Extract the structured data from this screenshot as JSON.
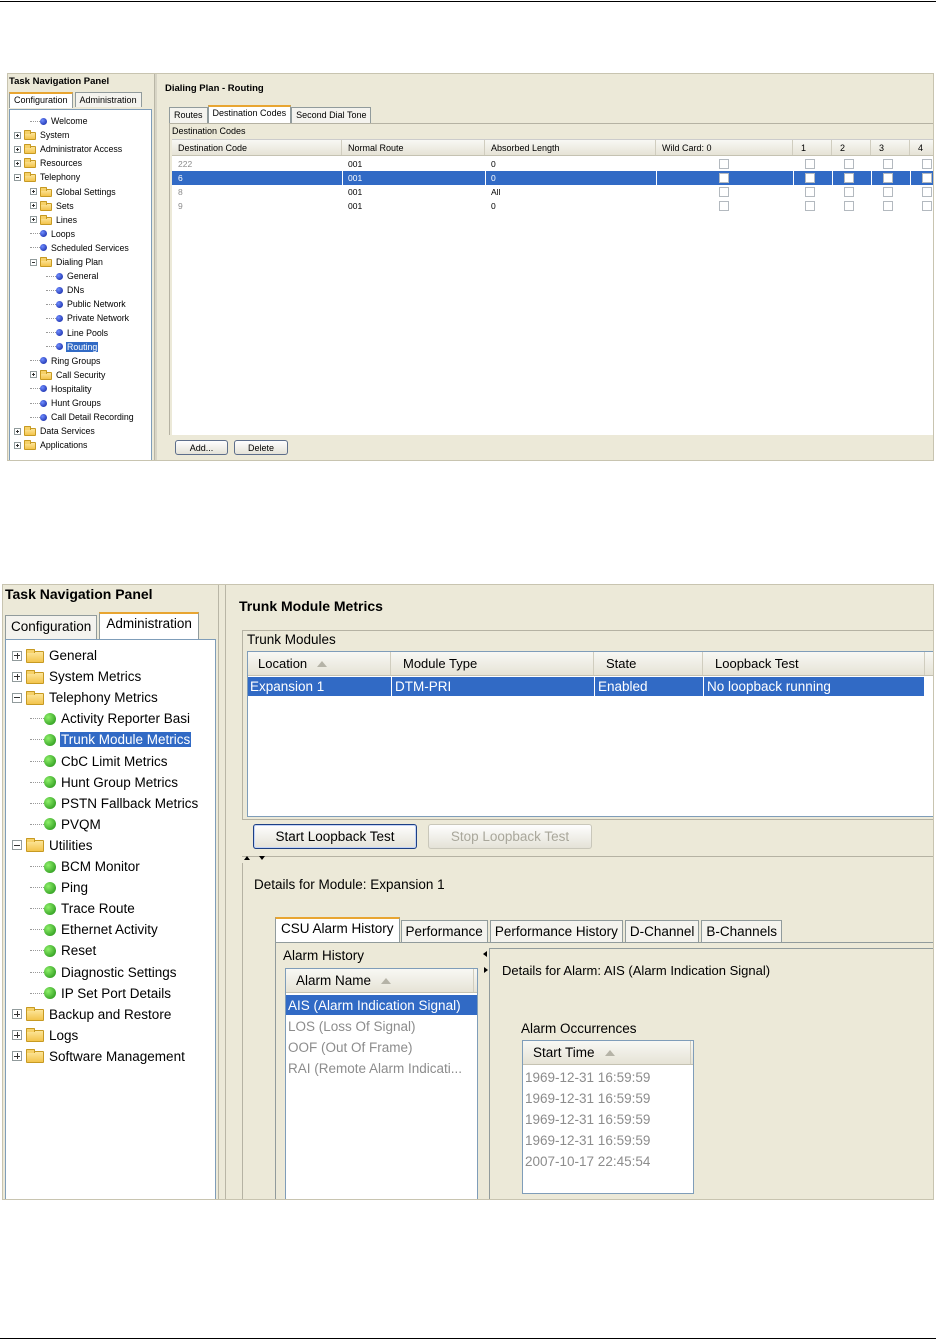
{
  "top": {
    "panel_title": "Task Navigation Panel",
    "tabs": [
      "Configuration",
      "Administration"
    ],
    "tree": [
      {
        "label": "Welcome",
        "icon": "bullet-blue"
      },
      {
        "label": "System",
        "icon": "folder"
      },
      {
        "label": "Administrator Access",
        "icon": "folder"
      },
      {
        "label": "Resources",
        "icon": "folder"
      },
      {
        "label": "Telephony",
        "icon": "folder"
      },
      {
        "label": "Global Settings",
        "icon": "folder"
      },
      {
        "label": "Sets",
        "icon": "folder"
      },
      {
        "label": "Lines",
        "icon": "folder"
      },
      {
        "label": "Loops",
        "icon": "bullet-blue"
      },
      {
        "label": "Scheduled Services",
        "icon": "bullet-blue"
      },
      {
        "label": "Dialing Plan",
        "icon": "folder"
      },
      {
        "label": "General",
        "icon": "bullet-blue"
      },
      {
        "label": "DNs",
        "icon": "bullet-blue"
      },
      {
        "label": "Public Network",
        "icon": "bullet-blue"
      },
      {
        "label": "Private Network",
        "icon": "bullet-blue"
      },
      {
        "label": "Line Pools",
        "icon": "bullet-blue"
      },
      {
        "label": "Routing",
        "icon": "bullet-blue",
        "selected": true
      },
      {
        "label": "Ring Groups",
        "icon": "bullet-blue"
      },
      {
        "label": "Call Security",
        "icon": "folder"
      },
      {
        "label": "Hospitality",
        "icon": "bullet-blue"
      },
      {
        "label": "Hunt Groups",
        "icon": "bullet-blue"
      },
      {
        "label": "Call Detail Recording",
        "icon": "bullet-blue"
      },
      {
        "label": "Data Services",
        "icon": "folder"
      },
      {
        "label": "Applications",
        "icon": "folder"
      }
    ],
    "page_title": "Dialing Plan - Routing",
    "content_tabs": [
      "Routes",
      "Destination Codes",
      "Second Dial Tone"
    ],
    "group_label": "Destination Codes",
    "columns": [
      "Destination Code",
      "Normal Route",
      "Absorbed Length",
      "Wild Card: 0",
      "1",
      "2",
      "3",
      "4"
    ],
    "rows": [
      {
        "code": "222",
        "route": "001",
        "absorbed": "0"
      },
      {
        "code": "6",
        "route": "001",
        "absorbed": "0",
        "selected": true
      },
      {
        "code": "8",
        "route": "001",
        "absorbed": "All"
      },
      {
        "code": "9",
        "route": "001",
        "absorbed": "0"
      }
    ],
    "buttons": {
      "add": "Add...",
      "delete": "Delete"
    }
  },
  "bottom": {
    "panel_title": "Task Navigation Panel",
    "tabs": [
      "Configuration",
      "Administration"
    ],
    "tree": [
      {
        "label": "General",
        "icon": "folder"
      },
      {
        "label": "System Metrics",
        "icon": "folder"
      },
      {
        "label": "Telephony Metrics",
        "icon": "folder"
      },
      {
        "label": "Activity Reporter Basi",
        "icon": "bullet-green"
      },
      {
        "label": "Trunk Module Metrics",
        "icon": "bullet-green",
        "selected": true
      },
      {
        "label": "CbC Limit Metrics",
        "icon": "bullet-green"
      },
      {
        "label": "Hunt Group Metrics",
        "icon": "bullet-green"
      },
      {
        "label": "PSTN Fallback Metrics",
        "icon": "bullet-green"
      },
      {
        "label": "PVQM",
        "icon": "bullet-green"
      },
      {
        "label": "Utilities",
        "icon": "folder"
      },
      {
        "label": "BCM Monitor",
        "icon": "bullet-green"
      },
      {
        "label": "Ping",
        "icon": "bullet-green"
      },
      {
        "label": "Trace Route",
        "icon": "bullet-green"
      },
      {
        "label": "Ethernet Activity",
        "icon": "bullet-green"
      },
      {
        "label": "Reset",
        "icon": "bullet-green"
      },
      {
        "label": "Diagnostic Settings",
        "icon": "bullet-green"
      },
      {
        "label": "IP Set Port Details",
        "icon": "bullet-green"
      },
      {
        "label": "Backup and Restore",
        "icon": "folder"
      },
      {
        "label": "Logs",
        "icon": "folder"
      },
      {
        "label": "Software Management",
        "icon": "folder"
      }
    ],
    "page_title": "Trunk Module Metrics",
    "group_label": "Trunk Modules",
    "columns": [
      "Location",
      "Module Type",
      "State",
      "Loopback Test"
    ],
    "rows": [
      {
        "location": "Expansion 1",
        "type": "DTM-PRI",
        "state": "Enabled",
        "loopback": "No loopback running",
        "selected": true
      }
    ],
    "buttons": {
      "start": "Start Loopback Test",
      "stop": "Stop Loopback Test"
    },
    "details_title": "Details for Module: Expansion 1",
    "detail_tabs": [
      "CSU Alarm History",
      "Performance",
      "Performance History",
      "D-Channel",
      "B-Channels"
    ],
    "alarm_history_label": "Alarm History",
    "alarm_column": "Alarm Name",
    "alarms": [
      {
        "name": "AIS (Alarm Indication Signal)",
        "selected": true
      },
      {
        "name": "LOS (Loss Of Signal)"
      },
      {
        "name": "OOF (Out Of Frame)"
      },
      {
        "name": "RAI (Remote Alarm Indicati..."
      }
    ],
    "alarm_details_title": "Details for Alarm: AIS (Alarm Indication Signal)",
    "occurrences_label": "Alarm Occurrences",
    "occurrences_column": "Start Time",
    "occurrences": [
      "1969-12-31 16:59:59",
      "1969-12-31 16:59:59",
      "1969-12-31 16:59:59",
      "1969-12-31 16:59:59",
      "2007-10-17 22:45:54"
    ]
  }
}
